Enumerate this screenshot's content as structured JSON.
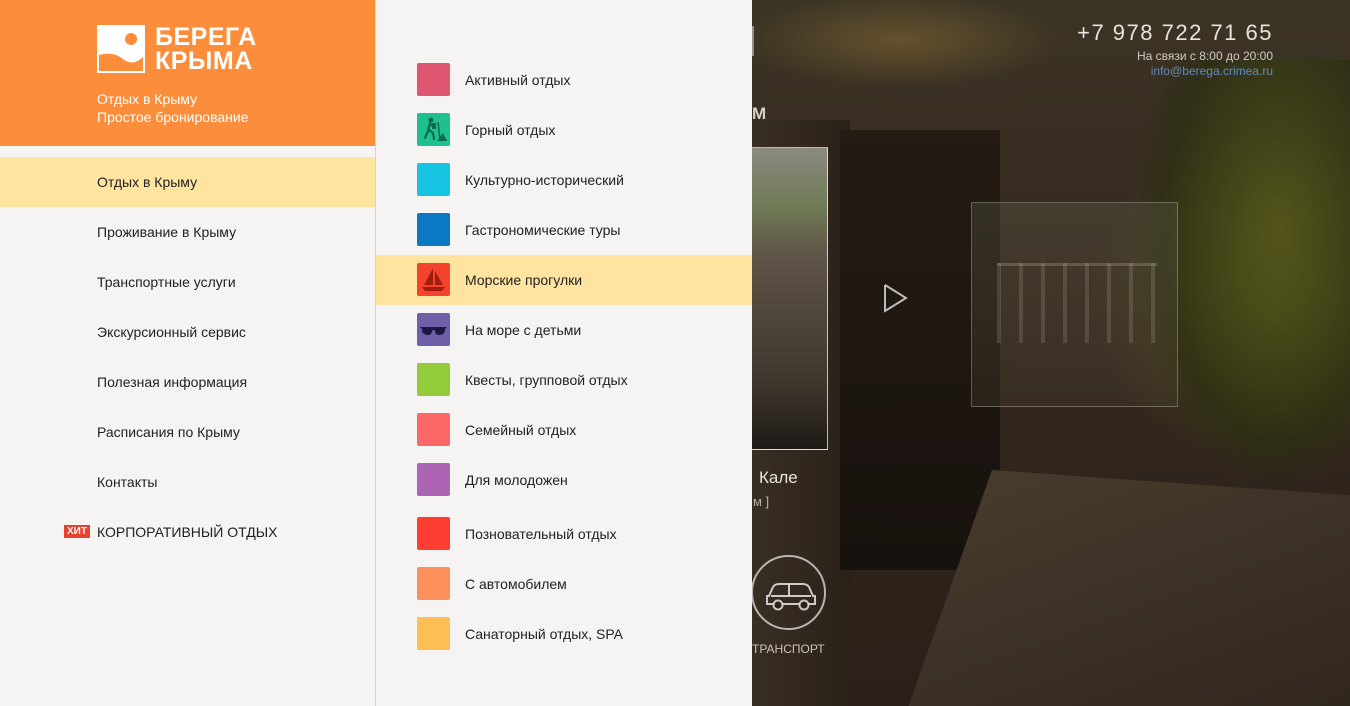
{
  "brand": {
    "logo_line1": "БЕРЕГА",
    "logo_line2": "КРЫМА",
    "tagline_line1": "Отдых в Крыму",
    "tagline_line2": "Простое бронирование",
    "color": "#fb8d3b"
  },
  "contact": {
    "phone": "+7 978 722 71 65",
    "hours": "На связи с 8:00 до 20:00",
    "email": "info@berega.crimea.ru"
  },
  "main_nav": {
    "items": [
      {
        "label": "Отдых в Крыму",
        "active": true
      },
      {
        "label": "Проживание в Крыму"
      },
      {
        "label": "Транспортные услуги"
      },
      {
        "label": "Экскурсионный сервис"
      },
      {
        "label": "Полезная информация"
      },
      {
        "label": "Расписания по Крыму"
      },
      {
        "label": "Контакты"
      },
      {
        "label": "КОРПОРАТИВНЫЙ ОТДЫХ",
        "badge": "ХИТ"
      }
    ],
    "active_color": "#ffe4a0",
    "badge_color": "#e8412f"
  },
  "submenu": {
    "items": [
      {
        "label": "Активный отдых",
        "color": "#e05570",
        "icon": "blank"
      },
      {
        "label": "Горный отдых",
        "color": "#1fc08f",
        "icon": "hiker-icon"
      },
      {
        "label": "Культурно-исторический",
        "color": "#17c5e3",
        "icon": "blank"
      },
      {
        "label": "Гастрономические туры",
        "color": "#0a78c2",
        "icon": "blank"
      },
      {
        "label": "Морские прогулки",
        "color": "#f4432c",
        "icon": "sailboat-icon",
        "active": true
      },
      {
        "label": "На море с детьми",
        "color": "#6f5ea8",
        "icon": "sunglasses-icon"
      },
      {
        "label": "Квесты, групповой отдых",
        "color": "#93cb3b",
        "icon": "blank"
      },
      {
        "label": "Семейный отдых",
        "color": "#fc6768",
        "icon": "blank"
      },
      {
        "label": "Для молодожен",
        "color": "#ad64b4",
        "icon": "blank"
      },
      {
        "label": "Позновательный отдых",
        "color": "#fd3d31",
        "icon": "blank"
      },
      {
        "label": "С автомобилем",
        "color": "#fd8f5c",
        "icon": "blank"
      },
      {
        "label": "Санаторный отдых, SPA",
        "color": "#fdbf53",
        "icon": "blank"
      }
    ]
  },
  "background": {
    "section_fragment": "М",
    "tour_title": "Кале",
    "tour_sub": "м ]",
    "transport_label": "ТРАНСПОРТ"
  }
}
